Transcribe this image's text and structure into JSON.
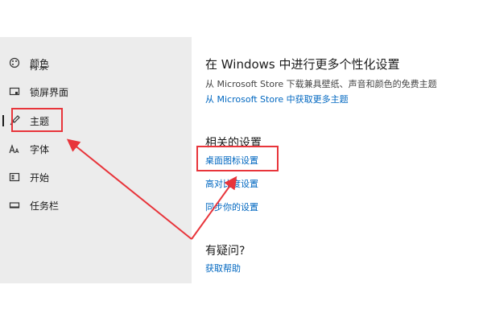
{
  "sidebar": {
    "partial_item_label": "背景",
    "items": [
      {
        "label": "颜色",
        "icon": "palette-icon"
      },
      {
        "label": "锁屏界面",
        "icon": "lock-screen-icon"
      },
      {
        "label": "主题",
        "icon": "brush-icon",
        "selected": true
      },
      {
        "label": "字体",
        "icon": "font-icon"
      },
      {
        "label": "开始",
        "icon": "start-icon"
      },
      {
        "label": "任务栏",
        "icon": "taskbar-icon"
      }
    ]
  },
  "main": {
    "personalize_title": "在 Windows 中进行更多个性化设置",
    "personalize_desc": "从 Microsoft Store 下载兼具壁纸、声音和颜色的免费主题",
    "store_link": "从 Microsoft Store 中获取更多主题",
    "related_title": "相关的设置",
    "related_links": [
      "桌面图标设置",
      "高对比度设置",
      "同步你的设置"
    ],
    "question_title": "有疑问?",
    "help_link": "获取帮助"
  },
  "colors": {
    "accent_link": "#0067c0",
    "annotation_red": "#e8353b",
    "sidebar_bg": "#ececec"
  }
}
